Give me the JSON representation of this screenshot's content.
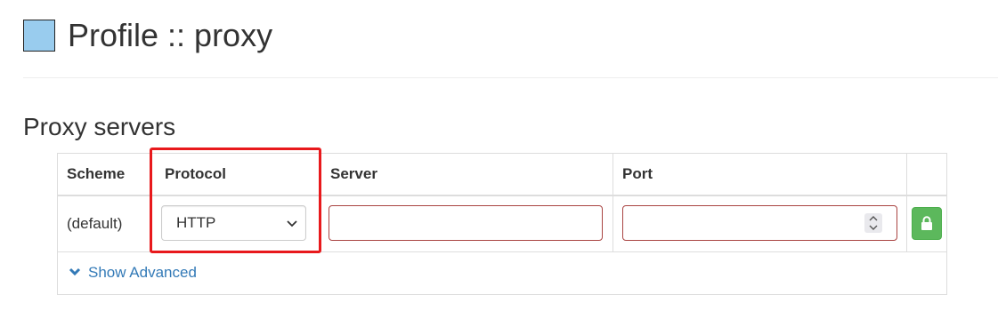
{
  "page": {
    "title": "Profile :: proxy",
    "swatch_color": "#99ccee"
  },
  "section": {
    "title": "Proxy servers"
  },
  "table": {
    "headers": {
      "scheme": "Scheme",
      "protocol": "Protocol",
      "server": "Server",
      "port": "Port"
    },
    "row": {
      "scheme": "(default)",
      "protocol": "HTTP",
      "server_value": "",
      "port_value": ""
    }
  },
  "advanced": {
    "label": "Show Advanced"
  },
  "icons": {
    "chevron": "chevron-down-icon",
    "spinner": "spinner-icon",
    "lock": "lock-icon",
    "advanced": "chevron-down-icon"
  },
  "colors": {
    "accent_link": "#337ab7",
    "lock_button": "#5cb85c",
    "highlight": "#e8191c",
    "input_error_border": "#a94442"
  }
}
